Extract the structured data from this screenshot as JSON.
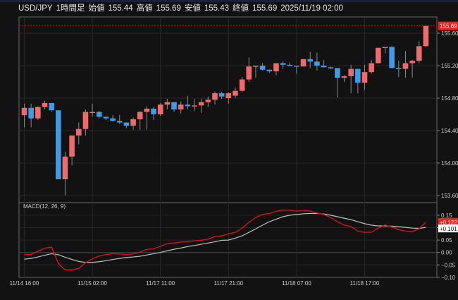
{
  "header": {
    "symbol": "USD/JPY",
    "timeframe": "1時間足",
    "open_label": "始値",
    "open": "155.44",
    "high_label": "高値",
    "high": "155.69",
    "low_label": "安値",
    "low": "155.43",
    "close_label": "終値",
    "close": "155.69",
    "datetime": "2025/11/19 02:00"
  },
  "colors": {
    "up": "#ef6a6a",
    "down": "#3d9be9",
    "macd": "#d0141e",
    "signal": "#bfbfbf",
    "last_price": "#ff1a1a"
  },
  "chart_data": [
    {
      "type": "candlestick",
      "title": "",
      "last_price_label": "155.69",
      "y_ticks": [
        "155.60",
        "155.20",
        "154.80",
        "154.40",
        "154.00",
        "153.60"
      ],
      "x_ticks": [
        "11/14 16:00",
        "11/15 02:00",
        "11/17 11:00",
        "11/17 21:00",
        "11/18 07:00",
        "11/18 17:00"
      ],
      "ylim": [
        153.52,
        155.72
      ],
      "grid": true,
      "candles": [
        [
          154.59,
          154.73,
          154.44,
          154.68
        ],
        [
          154.68,
          154.73,
          154.44,
          154.55
        ],
        [
          154.55,
          154.7,
          154.53,
          154.69
        ],
        [
          154.69,
          154.77,
          154.66,
          154.74
        ],
        [
          154.74,
          154.74,
          154.63,
          154.65
        ],
        [
          154.65,
          154.65,
          153.8,
          153.8
        ],
        [
          153.8,
          154.14,
          153.6,
          154.08
        ],
        [
          154.08,
          154.34,
          153.97,
          154.34
        ],
        [
          154.34,
          154.5,
          154.23,
          154.42
        ],
        [
          154.42,
          154.66,
          154.34,
          154.63
        ],
        [
          154.63,
          154.73,
          154.57,
          154.63
        ],
        [
          154.63,
          154.64,
          154.55,
          154.57
        ],
        [
          154.57,
          154.57,
          154.53,
          154.55
        ],
        [
          154.55,
          154.59,
          154.51,
          154.52
        ],
        [
          154.52,
          154.59,
          154.48,
          154.5
        ],
        [
          154.5,
          154.5,
          154.43,
          154.46
        ],
        [
          154.46,
          154.56,
          154.41,
          154.54
        ],
        [
          154.54,
          154.64,
          154.41,
          154.63
        ],
        [
          154.63,
          154.7,
          154.41,
          154.67
        ],
        [
          154.67,
          154.69,
          154.53,
          154.6
        ],
        [
          154.6,
          154.74,
          154.58,
          154.72
        ],
        [
          154.72,
          154.79,
          154.66,
          154.75
        ],
        [
          154.75,
          154.75,
          154.63,
          154.66
        ],
        [
          154.66,
          154.76,
          154.61,
          154.72
        ],
        [
          154.72,
          154.83,
          154.66,
          154.7
        ],
        [
          154.7,
          154.79,
          154.64,
          154.71
        ],
        [
          154.71,
          154.79,
          154.62,
          154.75
        ],
        [
          154.75,
          154.82,
          154.69,
          154.78
        ],
        [
          154.78,
          154.88,
          154.72,
          154.86
        ],
        [
          154.86,
          154.88,
          154.79,
          154.82
        ],
        [
          154.8,
          154.87,
          154.73,
          154.86
        ],
        [
          154.83,
          154.93,
          154.8,
          154.89
        ],
        [
          154.89,
          155.06,
          154.87,
          155.03
        ],
        [
          155.03,
          155.3,
          155.0,
          155.19
        ],
        [
          155.19,
          155.2,
          155.05,
          155.2
        ],
        [
          155.2,
          155.23,
          155.14,
          155.15
        ],
        [
          155.15,
          155.15,
          155.11,
          155.13
        ],
        [
          155.13,
          155.23,
          155.08,
          155.23
        ],
        [
          155.23,
          155.25,
          155.16,
          155.21
        ],
        [
          155.21,
          155.24,
          155.19,
          155.2
        ],
        [
          155.2,
          155.2,
          155.1,
          155.19
        ],
        [
          155.19,
          155.28,
          155.19,
          155.28
        ],
        [
          155.28,
          155.37,
          155.17,
          155.25
        ],
        [
          155.25,
          155.36,
          155.14,
          155.2
        ],
        [
          155.2,
          155.27,
          155.18,
          155.18
        ],
        [
          155.18,
          155.19,
          155.16,
          155.17
        ],
        [
          155.17,
          155.17,
          154.81,
          155.05
        ],
        [
          155.05,
          155.08,
          155.0,
          155.07
        ],
        [
          155.07,
          155.21,
          154.86,
          155.16
        ],
        [
          155.16,
          155.16,
          154.86,
          154.99
        ],
        [
          154.99,
          155.21,
          154.9,
          155.12
        ],
        [
          155.12,
          155.27,
          155.1,
          155.23
        ],
        [
          155.23,
          155.42,
          155.23,
          155.42
        ],
        [
          155.42,
          155.43,
          155.35,
          155.43
        ],
        [
          155.43,
          155.44,
          155.17,
          155.17
        ],
        [
          155.17,
          155.26,
          155.06,
          155.16
        ],
        [
          155.16,
          155.38,
          155.05,
          155.23
        ],
        [
          155.23,
          155.27,
          155.05,
          155.26
        ],
        [
          155.26,
          155.5,
          155.23,
          155.44
        ],
        [
          155.44,
          155.69,
          155.43,
          155.69
        ]
      ]
    },
    {
      "type": "line",
      "title": "MACD(12, 26, 9)",
      "ylim": [
        -0.1,
        0.19
      ],
      "y_ticks": [
        "0.15",
        "0.10",
        "0.05",
        "0.00",
        "−0.05",
        "−0.10"
      ],
      "grid": true,
      "macd_label": "+0.122",
      "signal_label": "+0.101",
      "series": [
        {
          "values": [
            -0.008,
            -0.008,
            0.005,
            0.017,
            0.022,
            -0.044,
            -0.07,
            -0.07,
            -0.064,
            -0.041,
            -0.025,
            -0.014,
            -0.008,
            -0.005,
            -0.006,
            -0.008,
            -0.006,
            0.002,
            0.012,
            0.015,
            0.025,
            0.036,
            0.038,
            0.042,
            0.044,
            0.047,
            0.049,
            0.054,
            0.064,
            0.067,
            0.075,
            0.081,
            0.098,
            0.122,
            0.141,
            0.153,
            0.157,
            0.166,
            0.17,
            0.17,
            0.166,
            0.169,
            0.167,
            0.159,
            0.153,
            0.141,
            0.124,
            0.11,
            0.105,
            0.086,
            0.081,
            0.082,
            0.098,
            0.111,
            0.103,
            0.092,
            0.086,
            0.084,
            0.096,
            0.122
          ]
        },
        {
          "values": [
            -0.027,
            -0.024,
            -0.018,
            -0.011,
            -0.005,
            -0.009,
            -0.019,
            -0.028,
            -0.036,
            -0.04,
            -0.04,
            -0.037,
            -0.033,
            -0.028,
            -0.024,
            -0.02,
            -0.018,
            -0.015,
            -0.01,
            -0.005,
            0.0,
            0.007,
            0.013,
            0.018,
            0.024,
            0.028,
            0.033,
            0.038,
            0.043,
            0.049,
            0.05,
            0.058,
            0.067,
            0.081,
            0.095,
            0.11,
            0.124,
            0.134,
            0.144,
            0.15,
            0.153,
            0.156,
            0.157,
            0.157,
            0.155,
            0.15,
            0.144,
            0.138,
            0.132,
            0.124,
            0.116,
            0.11,
            0.107,
            0.107,
            0.106,
            0.104,
            0.101,
            0.098,
            0.097,
            0.101
          ]
        }
      ]
    }
  ]
}
